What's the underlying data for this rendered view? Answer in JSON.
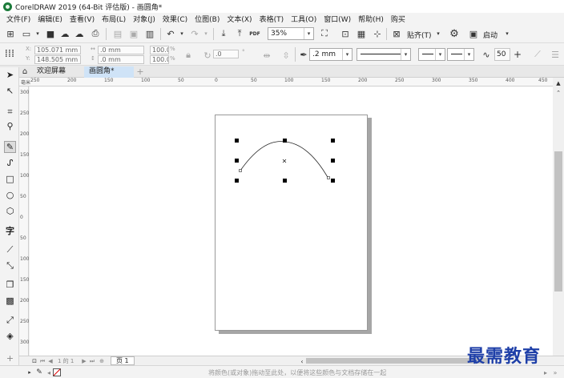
{
  "window": {
    "title": "CorelDRAW 2019 (64-Bit 评估版) - 画圆角*"
  },
  "menu": [
    "文件(F)",
    "编辑(E)",
    "查看(V)",
    "布局(L)",
    "对象(J)",
    "效果(C)",
    "位图(B)",
    "文本(X)",
    "表格(T)",
    "工具(O)",
    "窗口(W)",
    "帮助(H)",
    "购买"
  ],
  "toolbar": {
    "zoom_value": "35%",
    "snap_label": "贴齐(T)",
    "launch_label": "启动",
    "pdf_label": "PDF"
  },
  "properties": {
    "x_value": "105.071 mm",
    "y_value": "148.505 mm",
    "width_value": ".0 mm",
    "height_value": ".0 mm",
    "scale_x": "100.0",
    "scale_y": "100.0",
    "rotation_value": ".0",
    "outline_width": ".2 mm",
    "smoothing_value": "50"
  },
  "tabs": [
    {
      "label": "欢迎屏幕",
      "active": false
    },
    {
      "label": "画圆角*",
      "active": true
    }
  ],
  "ruler": {
    "horizontal": [
      "250",
      "200",
      "150",
      "100",
      "50",
      "0",
      "50",
      "100",
      "150",
      "200",
      "250",
      "300",
      "350",
      "400",
      "450"
    ],
    "vertical": [
      "300",
      "250",
      "200",
      "150",
      "100",
      "50",
      "0",
      "50",
      "100",
      "150",
      "200",
      "250",
      "300"
    ],
    "unit": "毫米"
  },
  "pagebar": {
    "page_counter": "1 的 1",
    "page_tab": "页 1"
  },
  "status": {
    "hint": "将颜色(或对象)拖动至此处，以便将这些颜色与文档存储在一起"
  },
  "watermark": {
    "text": "最需教育"
  },
  "colors": {
    "accent_tab": "#cfe3f7",
    "watermark": "#1e3fa8",
    "page_shadow": "#a6a6a6"
  }
}
